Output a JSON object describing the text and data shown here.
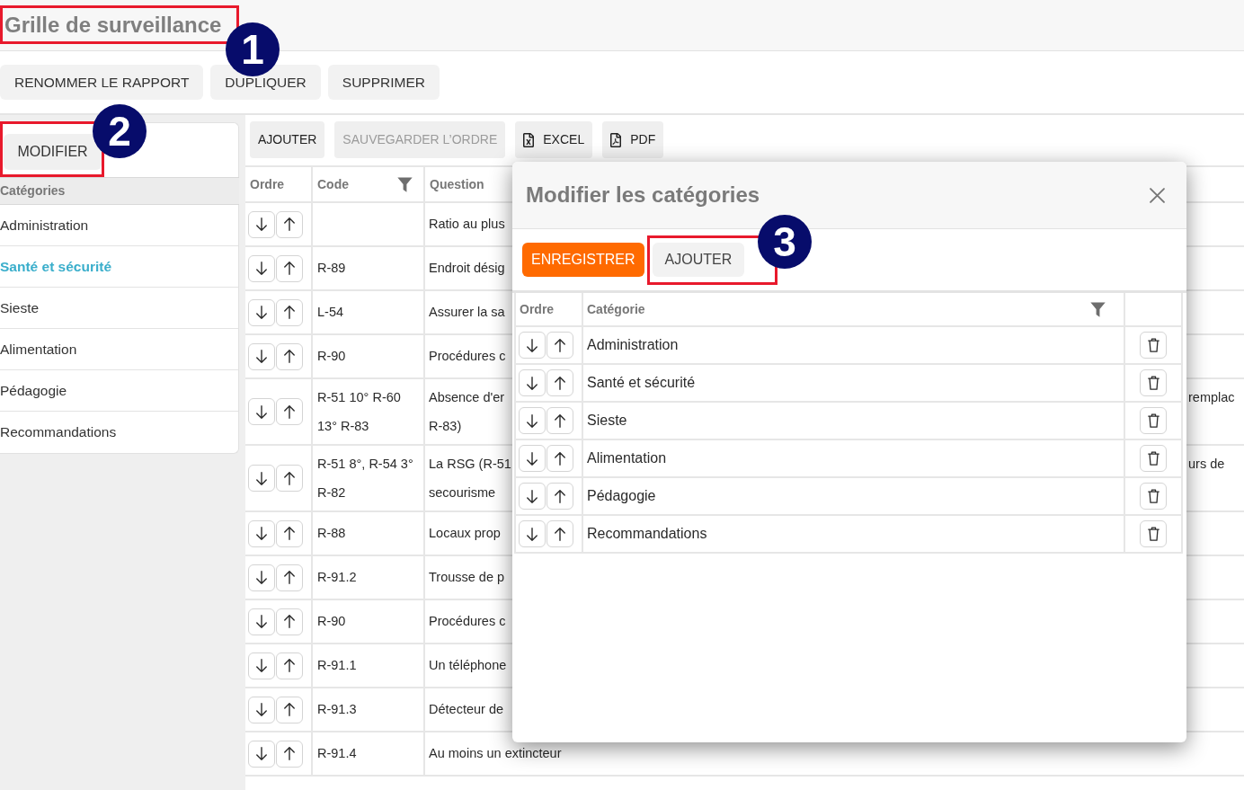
{
  "page": {
    "title": "Grille de surveillance",
    "callout": "1"
  },
  "report_actions": [
    {
      "label": "RENOMMER LE RAPPORT"
    },
    {
      "label": "DUPLIQUER"
    },
    {
      "label": "SUPPRIMER"
    }
  ],
  "sidebar": {
    "edit_button": {
      "label": "MODIFIER",
      "callout": "2"
    },
    "header": "Catégories",
    "items": [
      {
        "label": "Administration",
        "selected": false
      },
      {
        "label": "Santé et sécurité",
        "selected": true
      },
      {
        "label": "Sieste",
        "selected": false
      },
      {
        "label": "Alimentation",
        "selected": false
      },
      {
        "label": "Pédagogie",
        "selected": false
      },
      {
        "label": "Recommandations",
        "selected": false
      }
    ]
  },
  "toolbar": [
    {
      "label": "AJOUTER",
      "kind": "plain",
      "disabled": false
    },
    {
      "label": "SAUVEGARDER L’ORDRE",
      "kind": "plain",
      "disabled": true
    },
    {
      "label": "EXCEL",
      "kind": "excel",
      "disabled": false
    },
    {
      "label": "PDF",
      "kind": "pdf",
      "disabled": false
    }
  ],
  "table": {
    "columns": [
      {
        "label": "Ordre",
        "filter": false
      },
      {
        "label": "Code",
        "filter": true
      },
      {
        "label": "Question",
        "filter": false
      }
    ],
    "rows": [
      {
        "question": [
          "Ratio au plus"
        ]
      },
      {
        "code": [
          "R-89"
        ],
        "question": [
          "Endroit désig"
        ]
      },
      {
        "code": [
          "L-54"
        ],
        "question": [
          "Assurer la sa"
        ]
      },
      {
        "code": [
          "R-90"
        ],
        "question": [
          "Procédures c"
        ]
      },
      {
        "code": [
          "R-51 10° R-60",
          "13° R-83"
        ],
        "question": [
          "Absence d'er",
          "R-83)"
        ],
        "question_end": "remplac"
      },
      {
        "code": [
          "R-51 8°, R-54 3°",
          "R-82"
        ],
        "question": [
          "La RSG (R-51",
          "secourisme"
        ],
        "question_end": "urs de"
      },
      {
        "code": [
          "R-88"
        ],
        "question": [
          "Locaux prop"
        ]
      },
      {
        "code": [
          "R-91.2"
        ],
        "question": [
          "Trousse de p"
        ]
      },
      {
        "code": [
          "R-90"
        ],
        "question": [
          "Procédures c"
        ]
      },
      {
        "code": [
          "R-91.1"
        ],
        "question": [
          "Un téléphone"
        ]
      },
      {
        "code": [
          "R-91.3"
        ],
        "question": [
          "Détecteur de"
        ]
      },
      {
        "code": [
          "R-91.4"
        ],
        "question": [
          "Au moins un extincteur"
        ]
      }
    ]
  },
  "dialog": {
    "title": "Modifier les catégories",
    "actions": [
      {
        "label": "ENREGISTRER",
        "kind": "primary"
      },
      {
        "label": "AJOUTER",
        "kind": "secondary",
        "callout": "3"
      }
    ],
    "columns": [
      {
        "label": "Ordre",
        "filter": false
      },
      {
        "label": "Catégorie",
        "filter": true
      }
    ],
    "rows": [
      {
        "category": "Administration"
      },
      {
        "category": "Santé et sécurité"
      },
      {
        "category": "Sieste"
      },
      {
        "category": "Alimentation"
      },
      {
        "category": "Pédagogie"
      },
      {
        "category": "Recommandations"
      }
    ]
  }
}
